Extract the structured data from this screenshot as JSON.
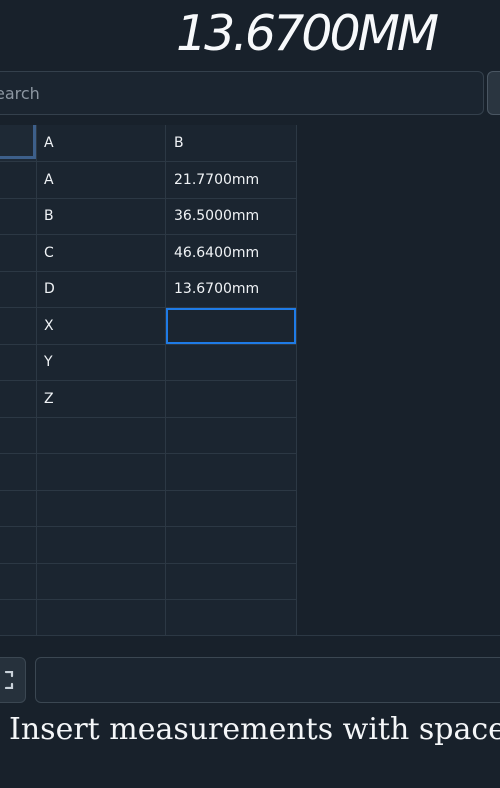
{
  "readout": {
    "value": "13.6700MM"
  },
  "search": {
    "placeholder": "Search",
    "visible_fragment": "earch"
  },
  "table": {
    "columns": [
      "A",
      "B"
    ],
    "rows": [
      {
        "a": "A",
        "b": "21.7700mm"
      },
      {
        "a": "B",
        "b": "36.5000mm"
      },
      {
        "a": "C",
        "b": "46.6400mm"
      },
      {
        "a": "D",
        "b": "13.6700mm"
      },
      {
        "a": "X",
        "b": ""
      },
      {
        "a": "Y",
        "b": ""
      },
      {
        "a": "Z",
        "b": ""
      }
    ],
    "selected_cell": "B-X"
  },
  "footer": {
    "hint": "Insert measurements with spaceb"
  },
  "colors": {
    "background": "#18212b",
    "grid_bg": "#1b2530",
    "grid_line": "#2c3844",
    "selection": "#1f7be6",
    "corner_accent": "#3d5f8a"
  },
  "icons": {
    "toggle": "bracket-icon"
  }
}
